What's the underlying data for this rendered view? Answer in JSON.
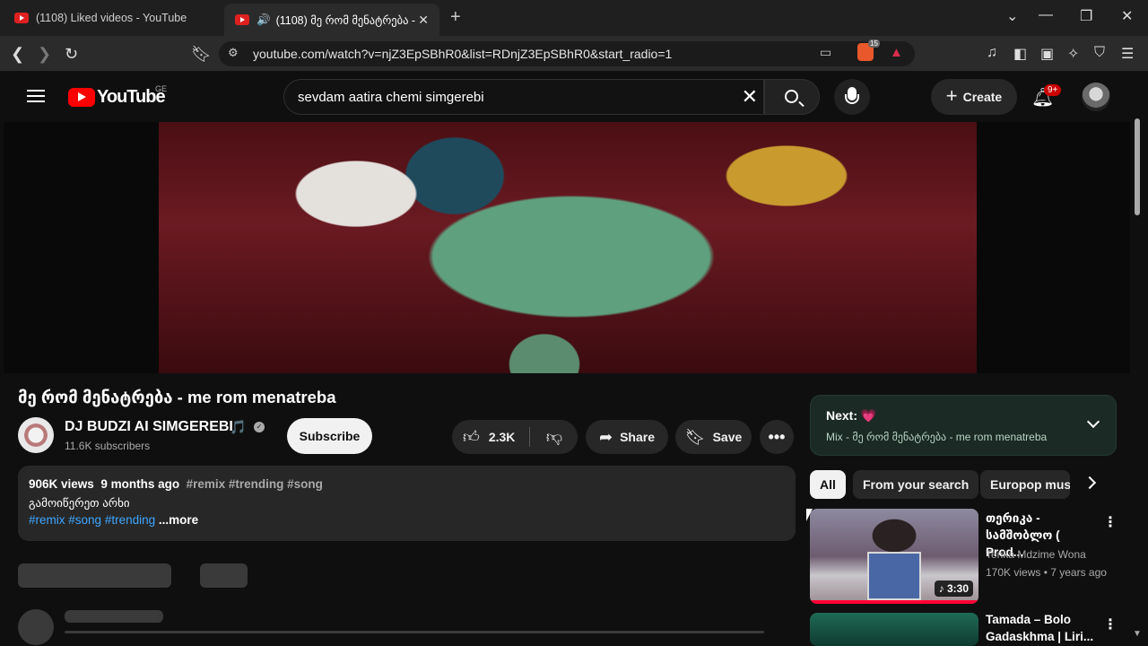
{
  "browser": {
    "tabs": [
      {
        "title": "(1108) Liked videos - YouTube"
      },
      {
        "title": "(1108) მე რომ მენატრება -"
      }
    ],
    "url": "youtube.com/watch?v=njZ3EpSBhR0&list=RDnjZ3EpSBhR0&start_radio=1",
    "brave_badge": "15"
  },
  "header": {
    "logo_text": "YouTube",
    "country": "GE",
    "search_value": "sevdam aatira chemi simgerebi",
    "create_label": "Create",
    "notif_badge": "9+"
  },
  "video": {
    "title": "მე რომ მენატრება - me rom menatreba",
    "channel": "DJ BUDZI  AI SIMGEREBI",
    "channel_note": "🎵",
    "subscribers": "11.6K subscribers",
    "subscribe_label": "Subscribe",
    "likes": "2.3K",
    "share_label": "Share",
    "save_label": "Save"
  },
  "description": {
    "views": "906K views",
    "age": "9 months ago",
    "tags_line": "#remix #trending #song",
    "line2": "გამოიწერეთ არხი",
    "tag1": "#remix",
    "tag2": "#song",
    "tag3": "#trending",
    "more": "...more"
  },
  "next_panel": {
    "label": "Next:",
    "heart": "💗",
    "subtitle": "Mix - მე რომ მენატრება - me rom menatreba"
  },
  "chips": [
    "All",
    "From your search",
    "Europop music"
  ],
  "recommendations": [
    {
      "title_line1": "თერიკა -",
      "title_line2": "სამშობლო ( Prod...",
      "channel": "Terika Mdzime Wona",
      "meta": "170K views • 7 years ago",
      "duration": "3:30"
    },
    {
      "title_line1": "Tamada – Bolo",
      "title_line2": "Gadaskhma | Liri..."
    }
  ]
}
